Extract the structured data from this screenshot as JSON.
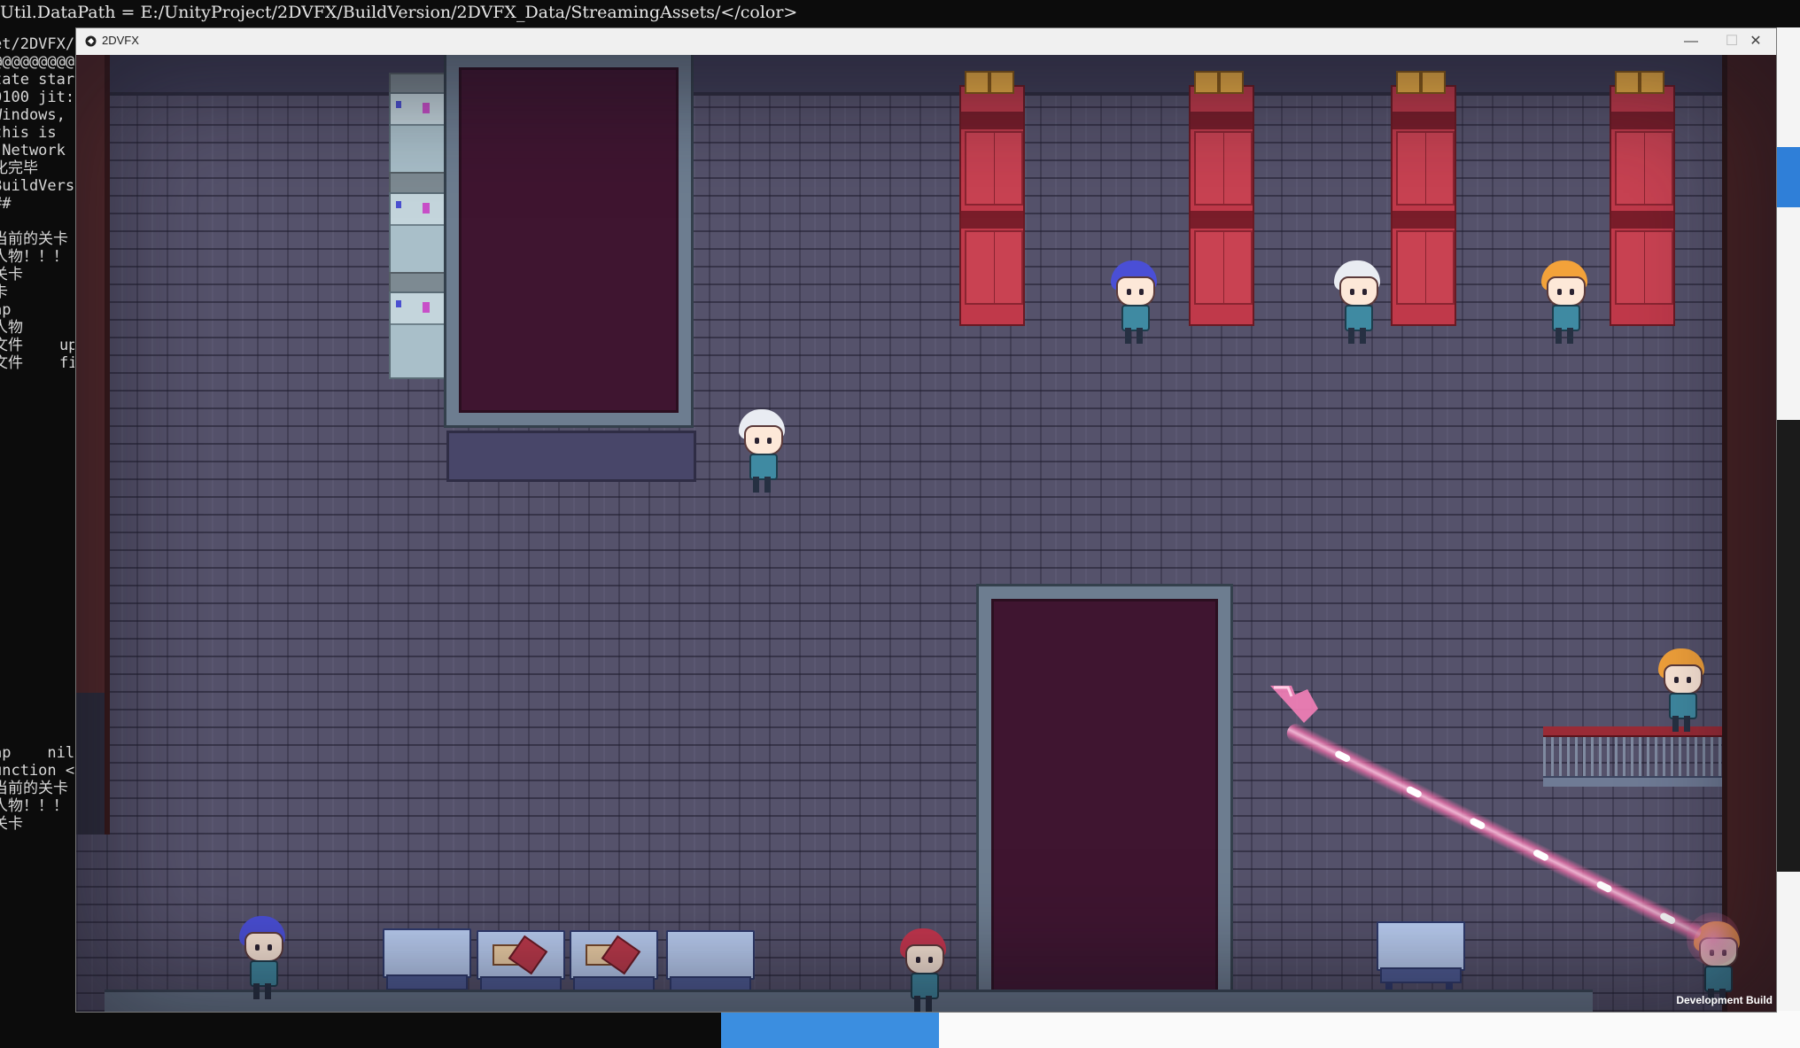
{
  "console": {
    "top_line": "Util.DataPath = E:/UnityProject/2DVFX/BuildVersion/2DVFX_Data/StreamingAssets/</color>",
    "left_lines": [
      "et/2DVFX/",
      "@@@@@@@@@@",
      "tate star",
      "0100 jit:",
      "Windows,",
      "this is",
      " Network",
      "化完毕",
      "BuildVers",
      "##",
      "",
      "当前的关卡",
      "人物！！！",
      "关卡",
      "卡",
      "ap",
      "人物",
      "文件    up",
      "文件    fi",
      "",
      "",
      "",
      "",
      "",
      "",
      "",
      "",
      "",
      "",
      "",
      "",
      "",
      "",
      "",
      "",
      "",
      "",
      "",
      "",
      "",
      "ap    nil",
      "unction <",
      "当前的关卡",
      "人物！！！",
      "关卡"
    ]
  },
  "window": {
    "title": "2DVFX",
    "minimize_glyph": "—",
    "maximize_glyph": "☐",
    "close_glyph": "✕"
  },
  "game": {
    "dev_build_label": "Development Build",
    "hair_colors": {
      "blue": "#4a4fd6",
      "white": "#e9ecf2",
      "orange": "#f3a23a",
      "red": "#c8364e"
    }
  }
}
